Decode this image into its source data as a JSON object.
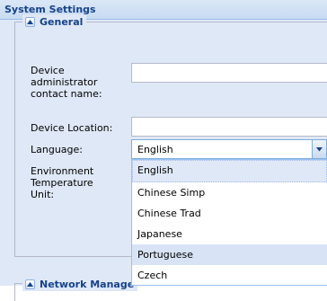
{
  "panel": {
    "title": "System Settings"
  },
  "general": {
    "legend": "General",
    "device_admin_label": "Device administrator contact name:",
    "device_admin_value": "",
    "device_location_label": "Device Location:",
    "device_location_value": "",
    "language_label": "Language:",
    "language_value": "English",
    "env_temp_label": "Environment Temperature Unit:"
  },
  "language_dropdown": {
    "options": [
      "English",
      "Chinese Simp",
      "Chinese Trad",
      "Japanese",
      "Portuguese",
      "Czech"
    ],
    "selected": "English",
    "highlighted": "Portuguese"
  },
  "network": {
    "legend": "Network Manage"
  },
  "icons": {
    "collapse": "collapse-arrow-icon",
    "dropdown": "chevron-down-icon"
  },
  "colors": {
    "header_text": "#15428b",
    "panel_bg": "#dfe8f6",
    "border": "#b5b8c8"
  }
}
